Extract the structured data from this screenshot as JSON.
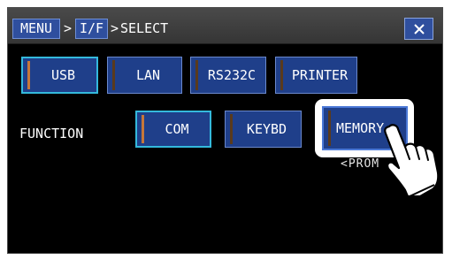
{
  "titlebar": {
    "menu_label": "MENU",
    "sep1": ">",
    "if_label": "I/F",
    "sep2": ">",
    "current": "SELECT",
    "close_icon": "close-icon"
  },
  "interface_buttons": [
    {
      "label": "USB",
      "selected": true
    },
    {
      "label": "LAN",
      "selected": false
    },
    {
      "label": "RS232C",
      "selected": false
    },
    {
      "label": "PRINTER",
      "selected": false
    }
  ],
  "function_row": {
    "label": "FUNCTION",
    "buttons": [
      {
        "label": "COM",
        "selected": true
      },
      {
        "label": "KEYBD",
        "selected": false
      },
      {
        "label": "MEMORY",
        "selected": false,
        "highlighted": true
      }
    ]
  },
  "partial_caption": "<PROM",
  "pointer_icon": "pointing-hand-icon",
  "colors": {
    "button_fill": "#1f3f8a",
    "selected_border": "#34b9dc",
    "selected_indicator": "#c6773a",
    "title_button": "#2f4f9e"
  }
}
